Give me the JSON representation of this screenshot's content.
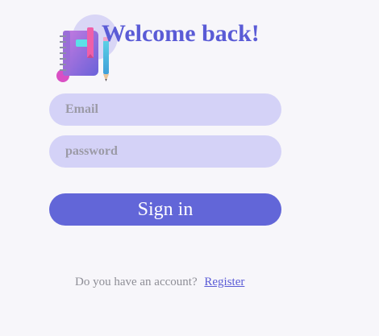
{
  "header": {
    "title": "Welcome back!",
    "logo_icon": "notebook-pencil-icon"
  },
  "form": {
    "email_placeholder": "Email",
    "email_value": "",
    "password_placeholder": "password",
    "password_value": "",
    "signin_label": "Sign in"
  },
  "footer": {
    "prompt": "Do you have an account?",
    "register_label": "Register"
  },
  "colors": {
    "accent": "#5a5bd6",
    "button": "#6266d8",
    "field_bg": "#d4d2f7",
    "page_bg": "#f7f6fa"
  }
}
